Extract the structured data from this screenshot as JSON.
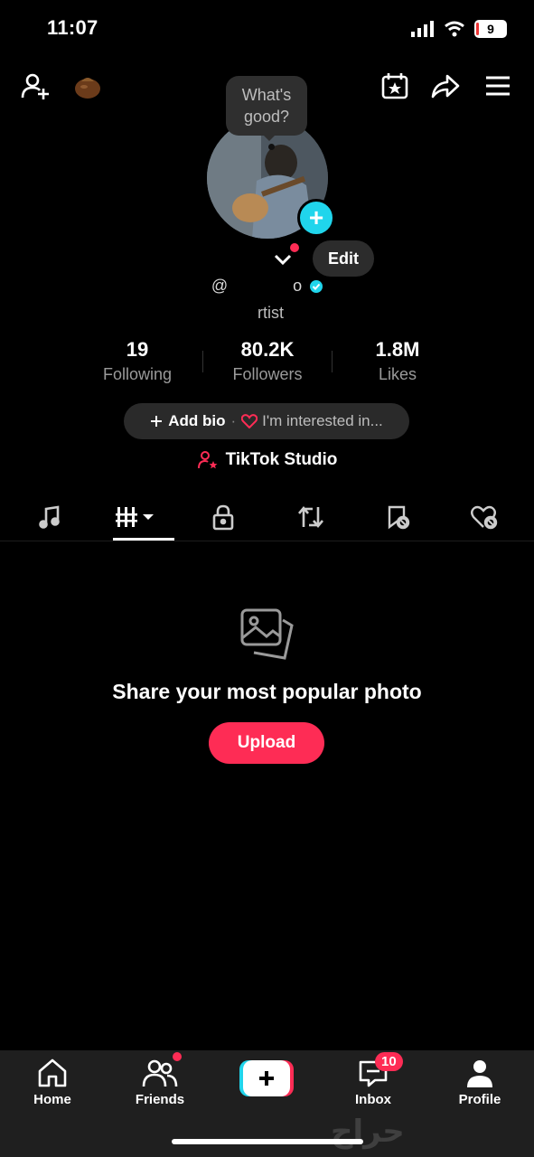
{
  "status_bar": {
    "time": "11:07",
    "battery": "9"
  },
  "bubble": {
    "line1": "What's",
    "line2": "good?"
  },
  "profile": {
    "edit_label": "Edit",
    "username_fragment_1": "@",
    "username_fragment_2": "o",
    "subtitle": "rtist"
  },
  "stats": [
    {
      "value": "19",
      "label": "Following"
    },
    {
      "value": "80.2K",
      "label": "Followers"
    },
    {
      "value": "1.8M",
      "label": "Likes"
    }
  ],
  "bio": {
    "add_label": "Add bio",
    "separator": "·",
    "interest_label": "I'm interested in..."
  },
  "studio": {
    "label": "TikTok Studio"
  },
  "empty_state": {
    "title": "Share your most popular photo",
    "button": "Upload"
  },
  "nav": {
    "home": "Home",
    "friends": "Friends",
    "create": "+",
    "inbox": "Inbox",
    "inbox_badge": "10",
    "profile": "Profile"
  },
  "watermark": "حراج",
  "colors": {
    "accent": "#fe2c55",
    "cyan": "#20d5ec",
    "background": "#000000"
  }
}
